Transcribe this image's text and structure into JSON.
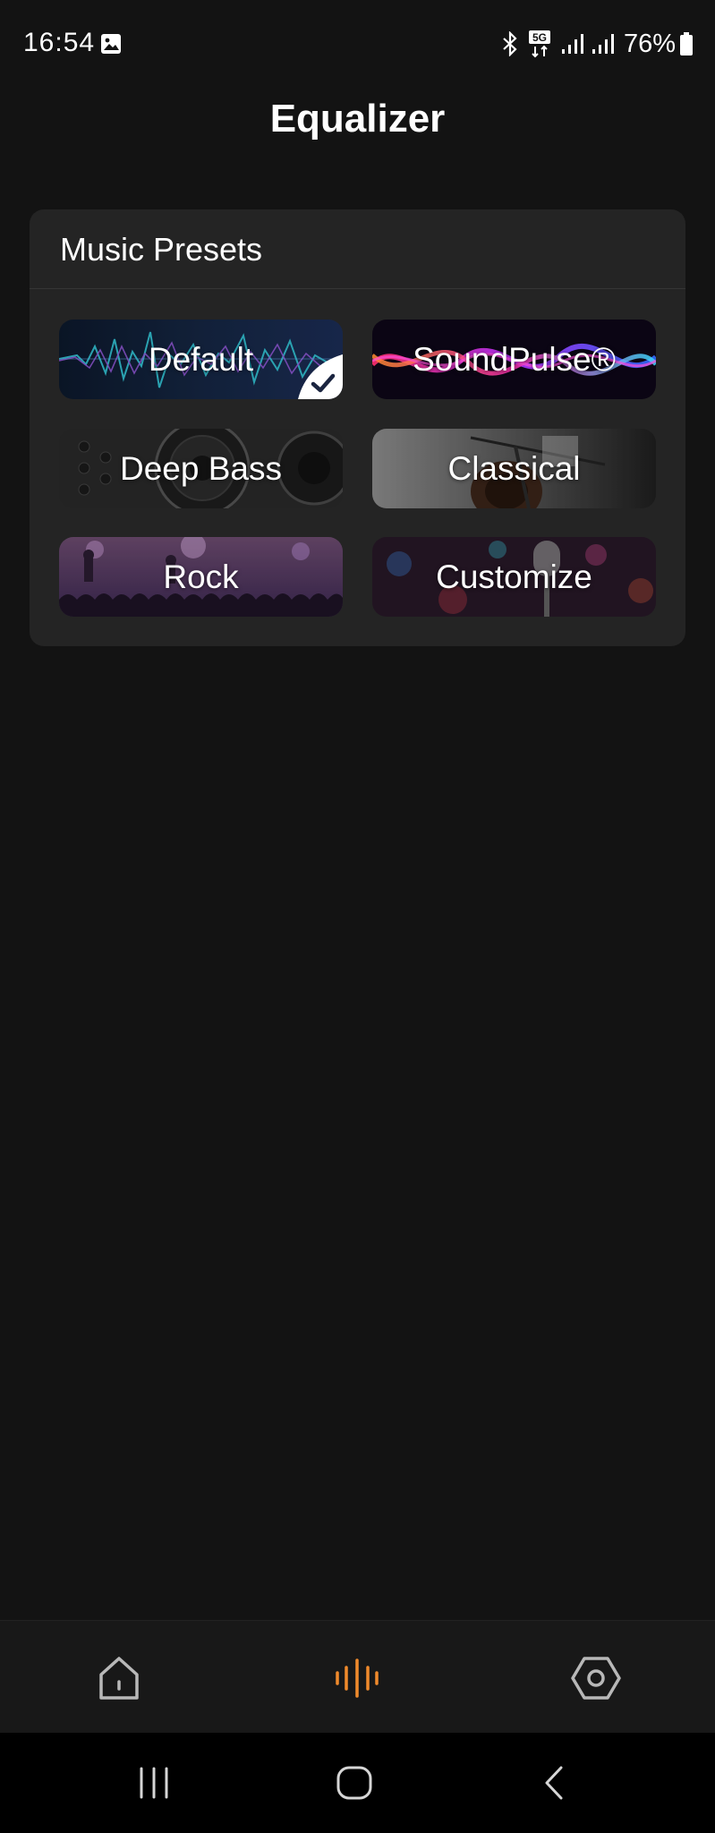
{
  "status_bar": {
    "time": "16:54",
    "battery": "76%",
    "icons": [
      "image-icon",
      "bluetooth-icon",
      "5g-icon",
      "signal-icon",
      "signal-icon",
      "battery-icon"
    ]
  },
  "header": {
    "title": "Equalizer"
  },
  "presets": {
    "title": "Music Presets",
    "selected": "Default",
    "items": [
      {
        "label": "Default",
        "selected": true
      },
      {
        "label": "SoundPulse®",
        "selected": false
      },
      {
        "label": "Deep Bass",
        "selected": false
      },
      {
        "label": "Classical",
        "selected": false
      },
      {
        "label": "Rock",
        "selected": false
      },
      {
        "label": "Customize",
        "selected": false
      }
    ]
  },
  "bottom_nav": {
    "items": [
      {
        "icon": "home-icon",
        "active": false
      },
      {
        "icon": "equalizer-icon",
        "active": true
      },
      {
        "icon": "settings-icon",
        "active": false
      }
    ],
    "active_color": "#f08a2c",
    "inactive_color": "#b8b8b8"
  },
  "system_nav": {
    "icons": [
      "recent-apps-icon",
      "home-button-icon",
      "back-icon"
    ]
  },
  "colors": {
    "background": "#131313",
    "card": "#242424",
    "accent": "#f08a2c"
  }
}
